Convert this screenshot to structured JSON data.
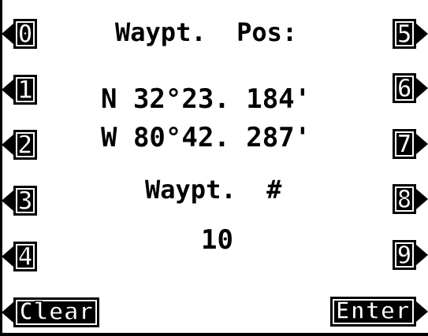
{
  "left_keys": [
    "0",
    "1",
    "2",
    "3",
    "4"
  ],
  "right_keys": [
    "5",
    "6",
    "7",
    "8",
    "9"
  ],
  "bottom_keys": {
    "clear": "Clear",
    "enter": "Enter"
  },
  "display": {
    "title": "Waypt.  Pos:",
    "latitude": "N 32°23. 184'",
    "longitude": "W 80°42. 287'",
    "waypoint_label": "Waypt.  #",
    "waypoint_number": "10"
  },
  "colors": {
    "foreground": "#000000",
    "background": "#ffffff"
  }
}
